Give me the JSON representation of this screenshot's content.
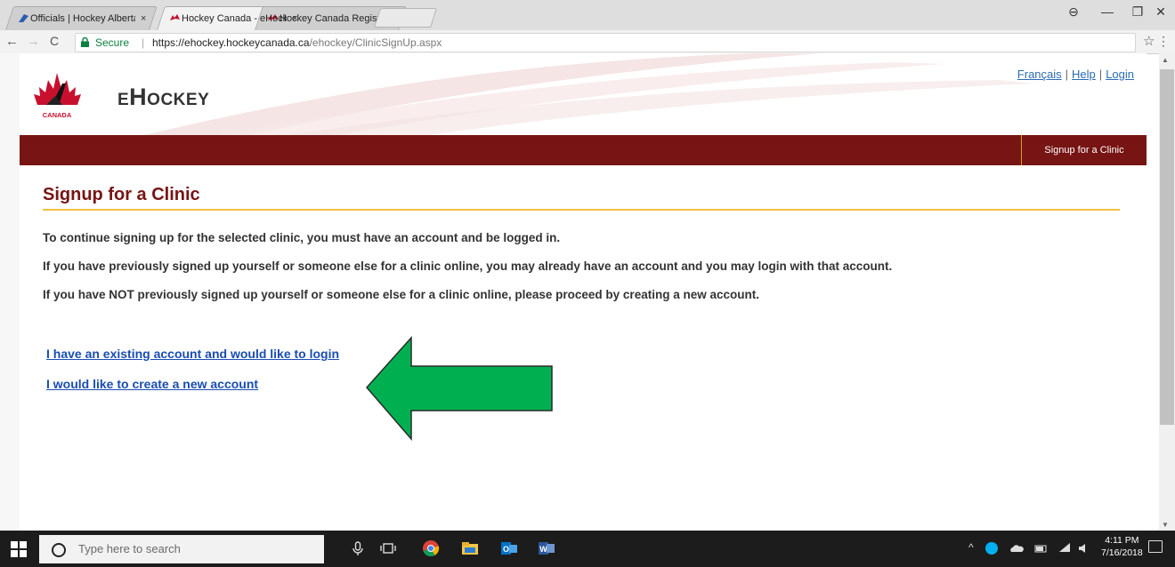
{
  "browser": {
    "tabs": [
      {
        "title": "Officials | Hockey Alberta",
        "close": "×"
      },
      {
        "title": "Hockey Canada - eHocke",
        "close": "×"
      },
      {
        "title": "Hockey Canada Registry",
        "close": "×"
      }
    ],
    "window_controls": {
      "account": "⊖",
      "minimize": "—",
      "maximize": "❐",
      "close": "✕"
    },
    "nav": {
      "back": "←",
      "forward": "→",
      "reload": "C"
    },
    "address": {
      "secure_label": "Secure",
      "separator": "|",
      "url_host": "https://ehockey.hockeycanada.ca",
      "url_path": "/ehockey/ClinicSignUp.aspx"
    },
    "star": "☆",
    "menu": "⋮"
  },
  "site": {
    "brand": "eHockey",
    "logo_caption": "CANADA",
    "top_links": [
      {
        "label": "Français"
      },
      {
        "label": "Help"
      },
      {
        "label": "Login"
      }
    ],
    "link_separator": "|",
    "menu": {
      "item": "Signup for a Clinic"
    }
  },
  "content": {
    "title": "Signup for a Clinic",
    "paragraphs": [
      "To continue signing up for the selected clinic, you must have an account and be logged in.",
      "If you have previously signed up yourself or someone else for a clinic online, you may already have an account and you may login with that account.",
      "If you have NOT previously signed up yourself or someone else for a clinic online, please proceed by creating a new account."
    ],
    "links": {
      "existing": "I have an existing account and would like to login",
      "create": "I would like to create a new account"
    }
  },
  "annotation": {
    "arrow_color": "#00b050"
  },
  "taskbar": {
    "search_placeholder": "Type here to search",
    "time": "4:11 PM",
    "date": "7/16/2018"
  },
  "colors": {
    "brand_red": "#771414",
    "accent_gold": "#f0c040",
    "link_blue": "#1a4db3"
  }
}
